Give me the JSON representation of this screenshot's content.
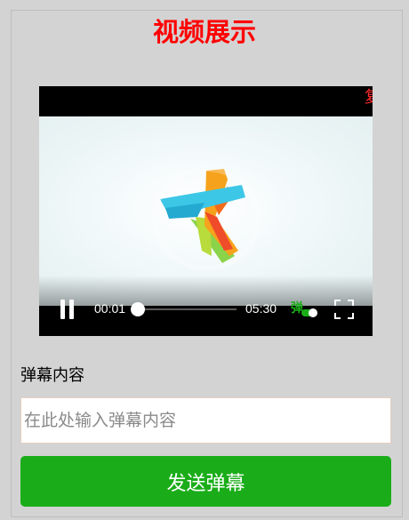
{
  "page": {
    "title": "视频展示"
  },
  "player": {
    "danmaku_text": "复",
    "current_time": "00:01",
    "total_time": "05:30",
    "progress": 0.01,
    "danmu_toggle_label": "弹",
    "danmu_enabled": true,
    "state": "playing",
    "icons": {
      "pause": "pause-icon",
      "fullscreen": "fullscreen-icon",
      "logo": "star-logo"
    }
  },
  "form": {
    "label": "弹幕内容",
    "input_value": "",
    "input_placeholder": "在此处输入弹幕内容",
    "send_label": "发送弹幕"
  },
  "colors": {
    "title": "#ff0000",
    "accent": "#1aad19",
    "danmaku": "#ff2a2a",
    "background": "#d3d3d3"
  }
}
